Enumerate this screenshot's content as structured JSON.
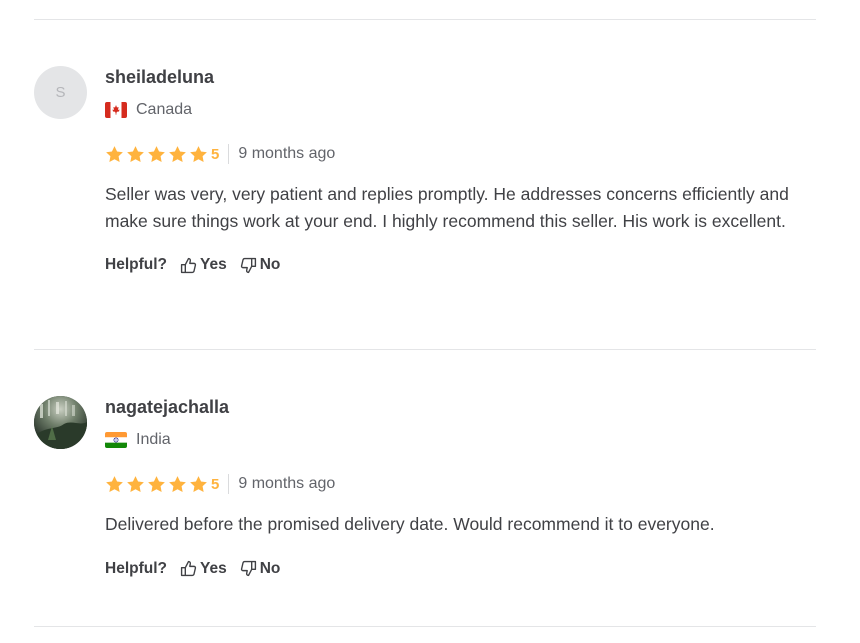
{
  "reviews": [
    {
      "avatar_letter": "S",
      "username": "sheiladeluna",
      "country": "Canada",
      "flag_icon": "flag-canada",
      "rating": "5",
      "stars": 5,
      "time": "9 months ago",
      "text": "Seller was very, very patient and replies promptly. He addresses concerns efficiently and make sure things work at your end. I highly recommend this seller. His work is excellent.",
      "helpful_label": "Helpful?",
      "yes_label": "Yes",
      "no_label": "No"
    },
    {
      "avatar_letter": "",
      "username": "nagatejachalla",
      "country": "India",
      "flag_icon": "flag-india",
      "rating": "5",
      "stars": 5,
      "time": "9 months ago",
      "text": "Delivered before the promised delivery date. Would recommend it to everyone.",
      "helpful_label": "Helpful?",
      "yes_label": "Yes",
      "no_label": "No"
    }
  ],
  "colors": {
    "star": "#ffb33e",
    "divider": "#e4e5e7",
    "text": "#404145",
    "muted": "#62646a"
  }
}
